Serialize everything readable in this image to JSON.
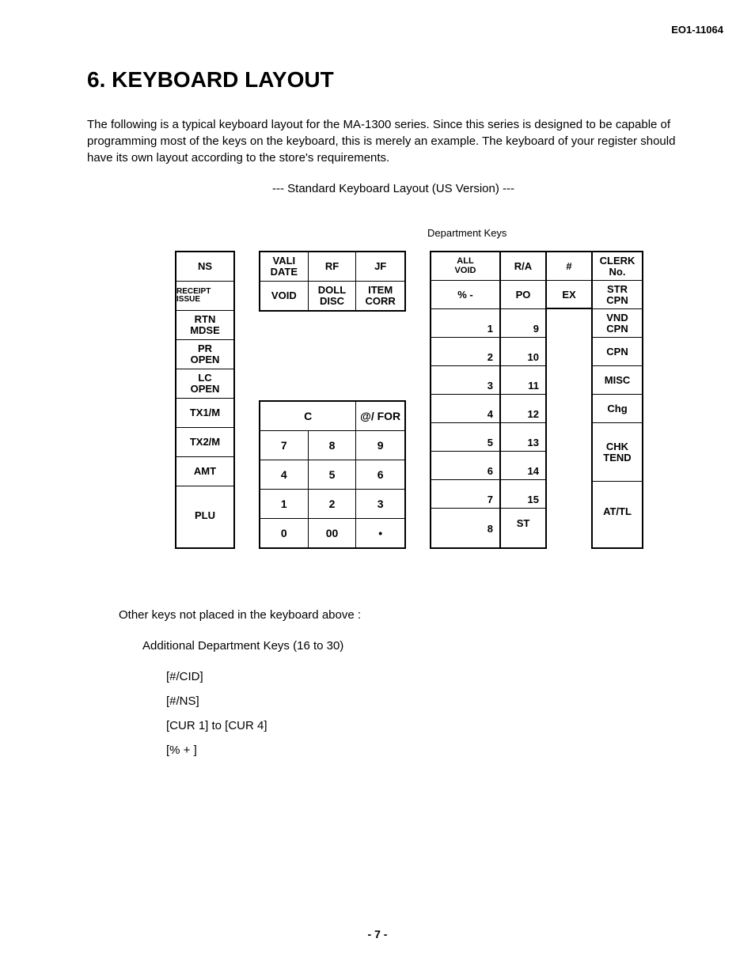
{
  "doc_id": "EO1-11064",
  "title": "6. KEYBOARD LAYOUT",
  "intro": "The following is a typical keyboard layout for the MA-1300 series.  Since this series is designed to be capable of programming most of the keys on the keyboard, this is merely an example.  The keyboard of your register should have its own layout according to the store's requirements.",
  "caption": "---   Standard Keyboard Layout (US Version)   ---",
  "dept_label": "Department Keys",
  "col1": {
    "k0": "NS",
    "k1": "RECEIPT ISSUE",
    "k2a": "RTN",
    "k2b": "MDSE",
    "k3a": "PR",
    "k3b": "OPEN",
    "k4a": "LC",
    "k4b": "OPEN",
    "k5": "TX1/M",
    "k6": "TX2/M",
    "k7": "AMT",
    "k8": "PLU"
  },
  "col2_top": {
    "r0c0a": "VALI",
    "r0c0b": "DATE",
    "r0c1": "RF",
    "r0c2": "JF",
    "r1c0": "VOID",
    "r1c1a": "DOLL",
    "r1c1b": "DISC",
    "r1c2a": "ITEM",
    "r1c2b": "CORR"
  },
  "numpad": {
    "c": "C",
    "atfor": "@/ FOR",
    "n7": "7",
    "n8": "8",
    "n9": "9",
    "n4": "4",
    "n5": "5",
    "n6": "6",
    "n1": "1",
    "n2": "2",
    "n3": "3",
    "n0": "0",
    "n00": "00",
    "dot": "•"
  },
  "dept_wide": {
    "r0a": "ALL",
    "r0b": "VOID",
    "r1": "% -",
    "r2": "1",
    "r3": "2",
    "r4": "3",
    "r5": "4",
    "r6": "5",
    "r7": "6",
    "r8": "7",
    "r9": "8"
  },
  "dept_mid1": {
    "r0": "R/A",
    "r1": "PO",
    "r2": "9",
    "r3": "10",
    "r4": "11",
    "r5": "12",
    "r6": "13",
    "r7": "14",
    "r8": "15",
    "r9": "ST"
  },
  "dept_mid0_r0": "#",
  "dept_mid0_r1": "EX",
  "func": {
    "r0a": "CLERK",
    "r0b": "No.",
    "r1a": "STR",
    "r1b": "CPN",
    "r2a": "VND",
    "r2b": "CPN",
    "r3": "CPN",
    "r4": "MISC",
    "r5": "Chg",
    "r6a": "CHK",
    "r6b": "TEND",
    "r7": "AT/TL"
  },
  "other_title": "Other keys not placed in the keyboard above :",
  "other_line1": "Additional Department Keys (16 to 30)",
  "other_k1": "[#/CID]",
  "other_k2": "[#/NS]",
  "other_k3": "[CUR 1] to [CUR 4]",
  "other_k4": "[% + ]",
  "page_num": "- 7 -"
}
